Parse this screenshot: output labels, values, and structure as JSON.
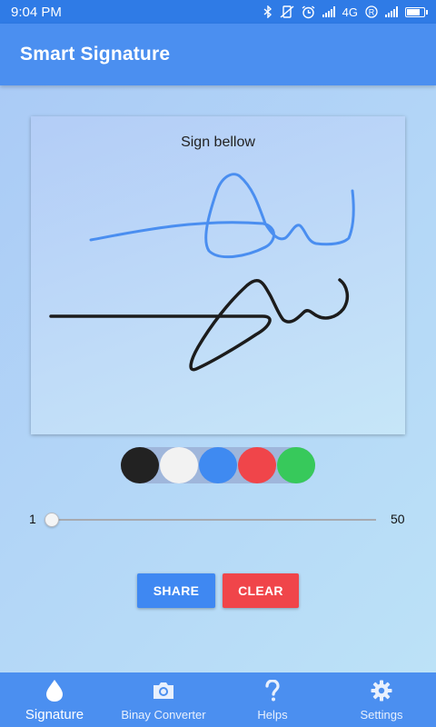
{
  "status_bar": {
    "time": "9:04 PM",
    "network": "4G",
    "icons": [
      "bluetooth-icon",
      "vibrate-icon",
      "alarm-icon",
      "signal-icon",
      "signal-icon",
      "roaming-icon",
      "battery-icon"
    ]
  },
  "app_bar": {
    "title": "Smart Signature"
  },
  "canvas": {
    "hint": "Sign bellow",
    "strokes": [
      {
        "color": "#4a8ef0",
        "width": 3
      },
      {
        "color": "#1c1c1c",
        "width": 3.5
      }
    ]
  },
  "palette": {
    "colors": [
      "#222222",
      "#f2f2f2",
      "#3f8af1",
      "#f0454a",
      "#37c95b"
    ],
    "names": [
      "black",
      "white",
      "blue",
      "red",
      "green"
    ]
  },
  "slider": {
    "min": "1",
    "max": "50",
    "value": 1
  },
  "buttons": {
    "share": {
      "label": "SHARE",
      "color": "#3f88f2"
    },
    "clear": {
      "label": "CLEAR",
      "color": "#f0454a"
    }
  },
  "bottom_nav": {
    "items": [
      {
        "label": "Signature",
        "icon": "drop-icon",
        "active": true
      },
      {
        "label": "Binay Converter",
        "icon": "camera-icon",
        "active": false
      },
      {
        "label": "Helps",
        "icon": "question-icon",
        "active": false
      },
      {
        "label": "Settings",
        "icon": "gear-icon",
        "active": false
      }
    ]
  },
  "theme": {
    "primary": "#4b8ff0",
    "status_bar": "#2f7be6"
  }
}
